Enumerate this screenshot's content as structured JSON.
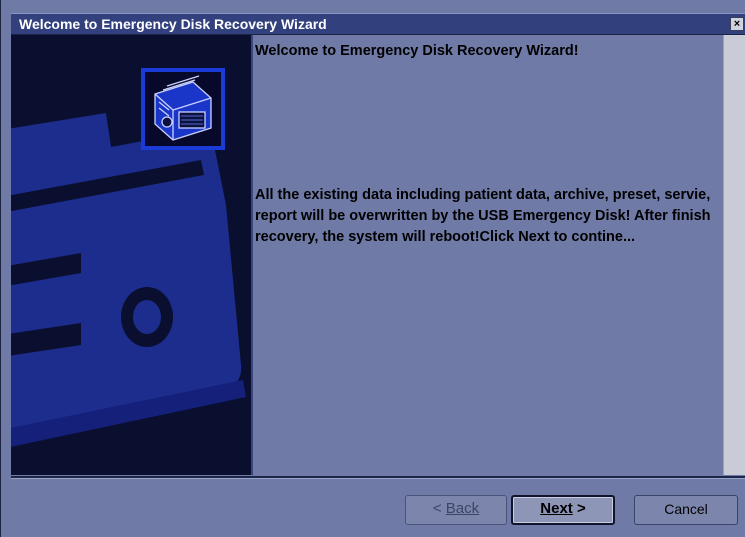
{
  "window": {
    "title": "Welcome to Emergency Disk Recovery Wizard",
    "close_glyph": "×"
  },
  "content": {
    "heading": "Welcome to Emergency Disk Recovery Wizard!",
    "message": "All the existing data including patient data, archive, preset, servie, report will be overwritten by the USB Emergency Disk! After finish recovery, the system will reboot!Click Next to contine..."
  },
  "buttons": {
    "back_prefix": "< ",
    "back_label": "Back",
    "next_label": "Next",
    "next_suffix": " >",
    "cancel_label": "Cancel"
  },
  "icons": {
    "banner": "disk-drive-banner-icon",
    "wizard": "hard-disk-icon"
  },
  "colors": {
    "titlebar": "#33407e",
    "panel": "#6f7aa6",
    "banner": "#0a0f30",
    "art": "#1c2d8e"
  }
}
